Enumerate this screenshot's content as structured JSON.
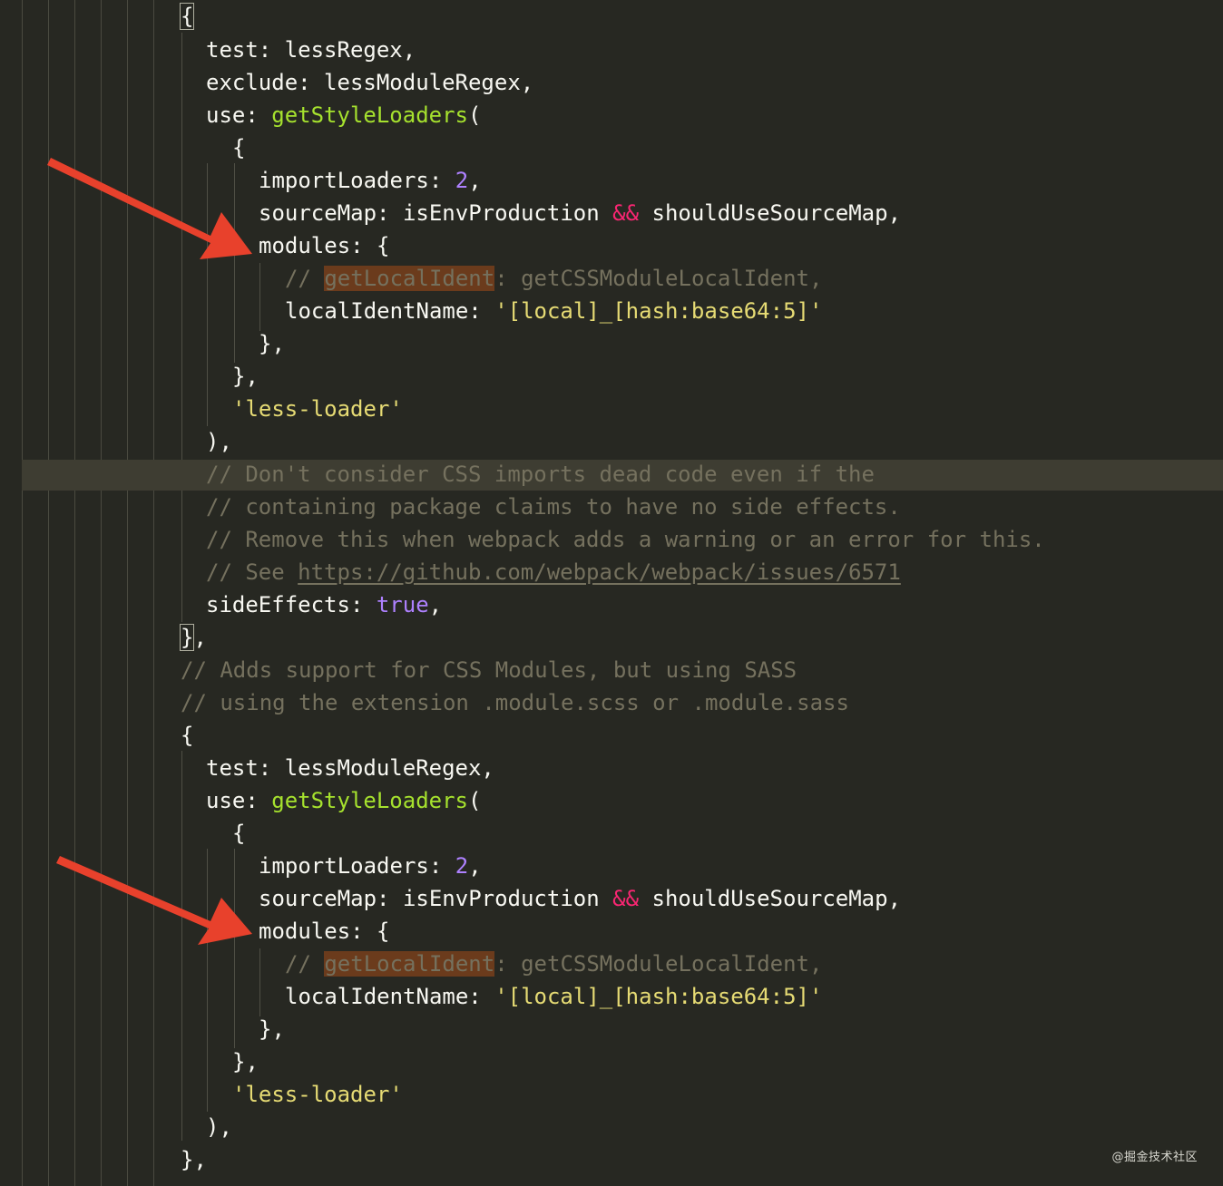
{
  "colors": {
    "background": "#272822",
    "current_line": "#3e3d32",
    "text": "#f8f8f2",
    "function": "#a6e22e",
    "number": "#ae81ff",
    "operator": "#f92672",
    "string": "#e6db74",
    "comment": "#75715e",
    "word_highlight": "#6b3b1c",
    "arrow": "#e8412c"
  },
  "code_lines": [
    {
      "tokens": [
        [
          "{",
          "plain"
        ]
      ]
    },
    {
      "tokens": [
        [
          "test: lessRegex,",
          "plain"
        ]
      ]
    },
    {
      "tokens": [
        [
          "exclude: lessModuleRegex,",
          "plain"
        ]
      ]
    },
    {
      "tokens": [
        [
          "use: ",
          "plain"
        ],
        [
          "getStyleLoaders",
          "func"
        ],
        [
          "(",
          "plain"
        ]
      ]
    },
    {
      "tokens": [
        [
          "{",
          "plain"
        ]
      ]
    },
    {
      "tokens": [
        [
          "importLoaders: ",
          "plain"
        ],
        [
          "2",
          "num"
        ],
        [
          ",",
          "plain"
        ]
      ]
    },
    {
      "tokens": [
        [
          "sourceMap: isEnvProduction ",
          "plain"
        ],
        [
          "&&",
          "op"
        ],
        [
          " shouldUseSourceMap,",
          "plain"
        ]
      ]
    },
    {
      "tokens": [
        [
          "modules: {",
          "plain"
        ]
      ]
    },
    {
      "tokens": [
        [
          "// ",
          "comment"
        ],
        [
          "getLocalIdent",
          "hl"
        ],
        [
          ": getCSSModuleLocalIdent,",
          "comment"
        ]
      ]
    },
    {
      "tokens": [
        [
          "localIdentName: ",
          "plain"
        ],
        [
          "'[local]_[hash:base64:5]'",
          "str"
        ]
      ]
    },
    {
      "tokens": [
        [
          "},",
          "plain"
        ]
      ]
    },
    {
      "tokens": [
        [
          "},",
          "plain"
        ]
      ]
    },
    {
      "tokens": [
        [
          "'less-loader'",
          "str"
        ]
      ]
    },
    {
      "tokens": [
        [
          "),",
          "plain"
        ]
      ]
    },
    {
      "tokens": [
        [
          "// Don't consider CSS imports dead code even if the",
          "comment"
        ]
      ]
    },
    {
      "tokens": [
        [
          "// containing package claims to have no side effects.",
          "comment"
        ]
      ]
    },
    {
      "tokens": [
        [
          "// Remove this when webpack adds a warning or an error for this.",
          "comment"
        ]
      ]
    },
    {
      "tokens": [
        [
          "// See ",
          "comment"
        ],
        [
          "https://github.com/webpack/webpack/issues/6571",
          "link"
        ]
      ]
    },
    {
      "tokens": [
        [
          "sideEffects: ",
          "plain"
        ],
        [
          "true",
          "kw"
        ],
        [
          ",",
          "plain"
        ]
      ]
    },
    {
      "tokens": [
        [
          "}",
          "plain"
        ],
        [
          ",",
          "plain"
        ]
      ]
    },
    {
      "tokens": [
        [
          "// Adds support for CSS Modules, but using SASS",
          "comment"
        ]
      ]
    },
    {
      "tokens": [
        [
          "// using the extension .module.scss or .module.sass",
          "comment"
        ]
      ]
    },
    {
      "tokens": [
        [
          "{",
          "plain"
        ]
      ]
    },
    {
      "tokens": [
        [
          "test: lessModuleRegex,",
          "plain"
        ]
      ]
    },
    {
      "tokens": [
        [
          "use: ",
          "plain"
        ],
        [
          "getStyleLoaders",
          "func"
        ],
        [
          "(",
          "plain"
        ]
      ]
    },
    {
      "tokens": [
        [
          "{",
          "plain"
        ]
      ]
    },
    {
      "tokens": [
        [
          "importLoaders: ",
          "plain"
        ],
        [
          "2",
          "num"
        ],
        [
          ",",
          "plain"
        ]
      ]
    },
    {
      "tokens": [
        [
          "sourceMap: isEnvProduction ",
          "plain"
        ],
        [
          "&&",
          "op"
        ],
        [
          " shouldUseSourceMap,",
          "plain"
        ]
      ]
    },
    {
      "tokens": [
        [
          "modules: {",
          "plain"
        ]
      ]
    },
    {
      "tokens": [
        [
          "// ",
          "comment"
        ],
        [
          "getLocalIdent",
          "hl"
        ],
        [
          ": getCSSModuleLocalIdent,",
          "comment"
        ]
      ]
    },
    {
      "tokens": [
        [
          "localIdentName: ",
          "plain"
        ],
        [
          "'[local]_[hash:base64:5]'",
          "str"
        ]
      ]
    },
    {
      "tokens": [
        [
          "},",
          "plain"
        ]
      ]
    },
    {
      "tokens": [
        [
          "},",
          "plain"
        ]
      ]
    },
    {
      "tokens": [
        [
          "'less-loader'",
          "str"
        ]
      ]
    },
    {
      "tokens": [
        [
          "),",
          "plain"
        ]
      ]
    },
    {
      "tokens": [
        [
          "},",
          "plain"
        ]
      ]
    }
  ],
  "annotations": [
    {
      "icon": "red-arrow-icon",
      "points_to": "modules: {"
    },
    {
      "icon": "red-arrow-icon",
      "points_to": "modules: {"
    }
  ],
  "watermark": "@掘金技术社区"
}
